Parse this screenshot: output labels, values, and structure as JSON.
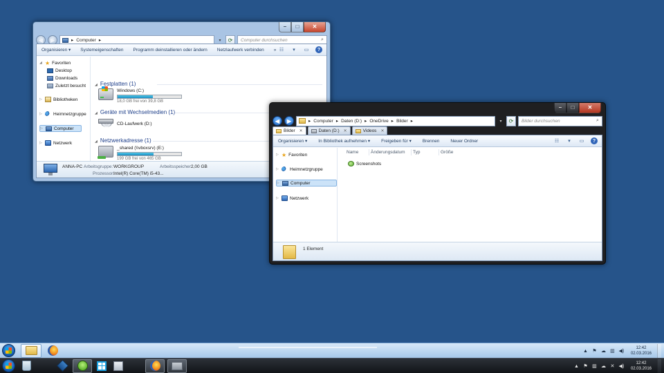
{
  "win_computer": {
    "address": [
      "Computer",
      "▸"
    ],
    "search_placeholder": "Computer durchsuchen",
    "toolbar": [
      "Organisieren ▾",
      "Systemeigenschaften",
      "Programm deinstallieren oder ändern",
      "Netzlaufwerk verbinden",
      "»"
    ],
    "nav": {
      "favoriten": "Favoriten",
      "desktop": "Desktop",
      "downloads": "Downloads",
      "recent": "Zuletzt besucht",
      "bibliotheken": "Bibliotheken",
      "heimnetz": "Heimnetzgruppe",
      "computer": "Computer",
      "netzwerk": "Netzwerk"
    },
    "groups": {
      "festplatten": "Festplatten (1)",
      "wechselmedien": "Geräte mit Wechselmedien (1)",
      "netzwerk": "Netzwerkadresse (1)"
    },
    "drives": {
      "c_name": "Windows (C:)",
      "c_free": "18,0 GB frei von 39,8 GB",
      "c_used_fraction": 0.55,
      "d_name": "CD-Laufwerk (D:)",
      "e_name": "_shared (\\\\vboxsrv) (E:)",
      "e_free": "199 GB frei von 465 GB",
      "e_used_fraction": 0.57
    },
    "details": {
      "pc_name": "ANNA-PC",
      "wg_label": "Arbeitsgruppe:",
      "wg_value": "WORKGROUP",
      "mem_label": "Arbeitsspeicher:",
      "mem_value": "2,00 GB",
      "cpu_label": "Prozessor:",
      "cpu_value": "Intel(R) Core(TM) i5-43..."
    }
  },
  "win_bilder": {
    "address": [
      "Computer",
      "Daten (D:)",
      "OneDrive",
      "Bilder"
    ],
    "address_sep": "▸",
    "search_placeholder": "Bilder durchsuchen",
    "tabs": [
      "Bilder",
      "Daten (D:)",
      "Videos"
    ],
    "toolbar": [
      "Organisieren ▾",
      "In Bibliothek aufnehmen ▾",
      "Freigeben für ▾",
      "Brennen",
      "Neuer Ordner"
    ],
    "nav": {
      "favoriten": "Favoriten",
      "heimnetz": "Heimnetzgruppe",
      "computer": "Computer",
      "netzwerk": "Netzwerk"
    },
    "columns": [
      "Name",
      "Änderungsdatum",
      "Typ",
      "Größe"
    ],
    "files": [
      "Screenshots"
    ],
    "status": "1 Element"
  },
  "taskbar_top": {
    "time": "12:42",
    "date": "02.03.2016"
  },
  "taskbar_bottom": {
    "time": "12:42",
    "date": "02.03.2016"
  }
}
